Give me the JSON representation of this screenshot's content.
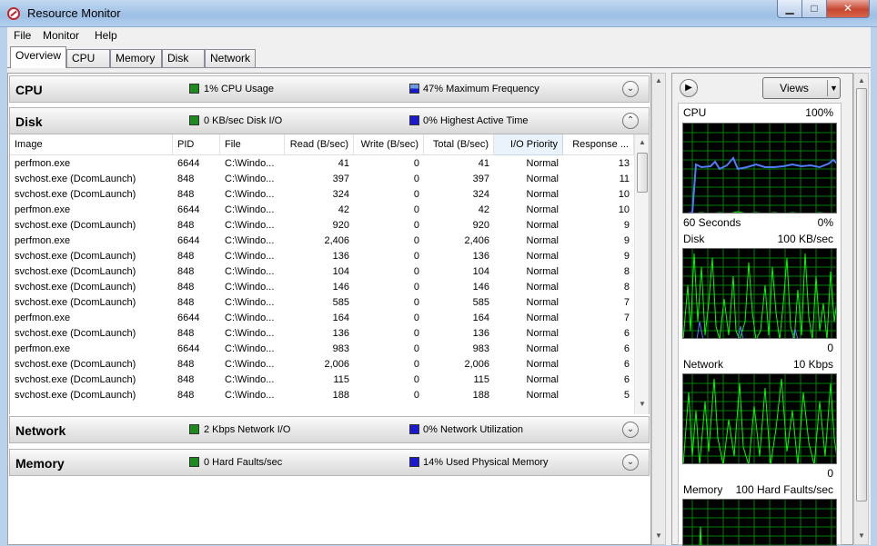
{
  "window": {
    "title": "Resource Monitor"
  },
  "window_buttons": {
    "minimize": "▁",
    "maximize": "□",
    "close": "✕"
  },
  "menu": [
    "File",
    "Monitor",
    "Help"
  ],
  "tabs": [
    "Overview",
    "CPU",
    "Memory",
    "Disk",
    "Network"
  ],
  "sections": {
    "cpu": {
      "title": "CPU",
      "stat1": "1% CPU Usage",
      "stat2": "47% Maximum Frequency",
      "chevron": "⌄"
    },
    "disk": {
      "title": "Disk",
      "stat1": "0 KB/sec Disk I/O",
      "stat2": "0% Highest Active Time",
      "chevron": "⌃"
    },
    "network": {
      "title": "Network",
      "stat1": "2 Kbps Network I/O",
      "stat2": "0% Network Utilization",
      "chevron": "⌄"
    },
    "memory": {
      "title": "Memory",
      "stat1": "0 Hard Faults/sec",
      "stat2": "14% Used Physical Memory",
      "chevron": "⌄"
    }
  },
  "disk_table": {
    "columns": [
      "Image",
      "PID",
      "File",
      "Read (B/sec)",
      "Write (B/sec)",
      "Total (B/sec)",
      "I/O Priority",
      "Response ..."
    ],
    "rows": [
      [
        "perfmon.exe",
        "6644",
        "C:\\Windo...",
        "41",
        "0",
        "41",
        "Normal",
        "13"
      ],
      [
        "svchost.exe (DcomLaunch)",
        "848",
        "C:\\Windo...",
        "397",
        "0",
        "397",
        "Normal",
        "11"
      ],
      [
        "svchost.exe (DcomLaunch)",
        "848",
        "C:\\Windo...",
        "324",
        "0",
        "324",
        "Normal",
        "10"
      ],
      [
        "perfmon.exe",
        "6644",
        "C:\\Windo...",
        "42",
        "0",
        "42",
        "Normal",
        "10"
      ],
      [
        "svchost.exe (DcomLaunch)",
        "848",
        "C:\\Windo...",
        "920",
        "0",
        "920",
        "Normal",
        "9"
      ],
      [
        "perfmon.exe",
        "6644",
        "C:\\Windo...",
        "2,406",
        "0",
        "2,406",
        "Normal",
        "9"
      ],
      [
        "svchost.exe (DcomLaunch)",
        "848",
        "C:\\Windo...",
        "136",
        "0",
        "136",
        "Normal",
        "9"
      ],
      [
        "svchost.exe (DcomLaunch)",
        "848",
        "C:\\Windo...",
        "104",
        "0",
        "104",
        "Normal",
        "8"
      ],
      [
        "svchost.exe (DcomLaunch)",
        "848",
        "C:\\Windo...",
        "146",
        "0",
        "146",
        "Normal",
        "8"
      ],
      [
        "svchost.exe (DcomLaunch)",
        "848",
        "C:\\Windo...",
        "585",
        "0",
        "585",
        "Normal",
        "7"
      ],
      [
        "perfmon.exe",
        "6644",
        "C:\\Windo...",
        "164",
        "0",
        "164",
        "Normal",
        "7"
      ],
      [
        "svchost.exe (DcomLaunch)",
        "848",
        "C:\\Windo...",
        "136",
        "0",
        "136",
        "Normal",
        "6"
      ],
      [
        "perfmon.exe",
        "6644",
        "C:\\Windo...",
        "983",
        "0",
        "983",
        "Normal",
        "6"
      ],
      [
        "svchost.exe (DcomLaunch)",
        "848",
        "C:\\Windo...",
        "2,006",
        "0",
        "2,006",
        "Normal",
        "6"
      ],
      [
        "svchost.exe (DcomLaunch)",
        "848",
        "C:\\Windo...",
        "115",
        "0",
        "115",
        "Normal",
        "6"
      ],
      [
        "svchost.exe (DcomLaunch)",
        "848",
        "C:\\Windo...",
        "188",
        "0",
        "188",
        "Normal",
        "5"
      ]
    ]
  },
  "right_panel": {
    "views_label": "Views",
    "graphs": [
      {
        "name": "CPU",
        "max": "100%",
        "footer_left": "60 Seconds",
        "footer_right": "0%"
      },
      {
        "name": "Disk",
        "max": "100 KB/sec",
        "footer_left": "",
        "footer_right": "0"
      },
      {
        "name": "Network",
        "max": "10 Kbps",
        "footer_left": "",
        "footer_right": "0"
      },
      {
        "name": "Memory",
        "max": "100 Hard Faults/sec",
        "footer_left": "",
        "footer_right": ""
      }
    ]
  },
  "colors": {
    "graph_bg": "#000000",
    "graph_grid": "#008000",
    "graph_line_green": "#00ff00",
    "graph_line_blue": "#4f7bff",
    "stat_green": "#1d8a1d",
    "stat_blue": "#1a1acf"
  }
}
